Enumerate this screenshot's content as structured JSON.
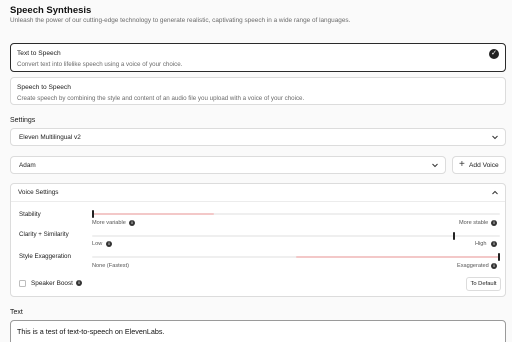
{
  "header": {
    "title": "Speech Synthesis",
    "subtitle": "Unleash the power of our cutting-edge technology to generate realistic, captivating speech in a wide range of languages."
  },
  "modes": [
    {
      "title": "Text to Speech",
      "description": "Convert text into lifelike speech using a voice of your choice.",
      "selected": true
    },
    {
      "title": "Speech to Speech",
      "description": "Create speech by combining the style and content of an audio file you upload with a voice of your choice.",
      "selected": false
    }
  ],
  "settings": {
    "label": "Settings",
    "model": "Eleven Multilingual v2",
    "voice": "Adam",
    "add_voice_label": "Add Voice"
  },
  "voice_settings": {
    "header": "Voice Settings",
    "stability": {
      "label": "Stability",
      "min_label": "More variable",
      "max_label": "More stable",
      "value": 0.0
    },
    "clarity": {
      "label": "Clarity + Similarity",
      "min_label": "Low",
      "max_label": "High",
      "value": 0.89
    },
    "style": {
      "label": "Style Exaggeration",
      "min_label": "None (Fastest)",
      "max_label": "Exaggerated",
      "value": 1.0
    },
    "speaker_boost": {
      "label": "Speaker Boost",
      "checked": false
    },
    "to_default_label": "To Default"
  },
  "text_section": {
    "label": "Text",
    "value": "This is a test of text-to-speech on ElevenLabs."
  },
  "colors": {
    "accent_fill": "#f3c8c8",
    "border": "#dcdcdc",
    "selected_border": "#2b2b2b"
  }
}
